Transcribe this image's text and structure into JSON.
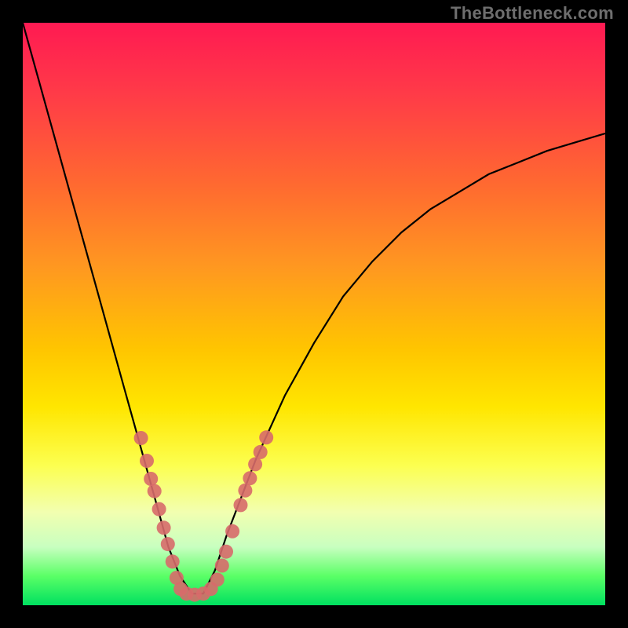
{
  "watermark": "TheBottleneck.com",
  "chart_data": {
    "type": "line",
    "title": "",
    "xlabel": "",
    "ylabel": "",
    "xlim": [
      0,
      1
    ],
    "ylim": [
      0,
      1
    ],
    "grid": false,
    "series": [
      {
        "name": "bottleneck-curve",
        "x": [
          0.0,
          0.025,
          0.05,
          0.075,
          0.1,
          0.125,
          0.15,
          0.175,
          0.2,
          0.225,
          0.25,
          0.27,
          0.29,
          0.31,
          0.33,
          0.35,
          0.4,
          0.45,
          0.5,
          0.55,
          0.6,
          0.65,
          0.7,
          0.75,
          0.8,
          0.85,
          0.9,
          0.95,
          1.0
        ],
        "y": [
          1.0,
          0.91,
          0.82,
          0.73,
          0.64,
          0.55,
          0.46,
          0.37,
          0.28,
          0.19,
          0.1,
          0.05,
          0.02,
          0.02,
          0.06,
          0.12,
          0.25,
          0.36,
          0.45,
          0.53,
          0.59,
          0.64,
          0.68,
          0.71,
          0.74,
          0.76,
          0.78,
          0.795,
          0.81
        ]
      }
    ],
    "markers": {
      "name": "dots",
      "color": "#d76a6a",
      "radius_px": 9,
      "points": [
        {
          "x": 0.203,
          "y": 0.287
        },
        {
          "x": 0.213,
          "y": 0.248
        },
        {
          "x": 0.22,
          "y": 0.217
        },
        {
          "x": 0.226,
          "y": 0.196
        },
        {
          "x": 0.234,
          "y": 0.165
        },
        {
          "x": 0.242,
          "y": 0.133
        },
        {
          "x": 0.249,
          "y": 0.105
        },
        {
          "x": 0.257,
          "y": 0.075
        },
        {
          "x": 0.264,
          "y": 0.047
        },
        {
          "x": 0.271,
          "y": 0.028
        },
        {
          "x": 0.281,
          "y": 0.02
        },
        {
          "x": 0.295,
          "y": 0.018
        },
        {
          "x": 0.31,
          "y": 0.02
        },
        {
          "x": 0.323,
          "y": 0.028
        },
        {
          "x": 0.334,
          "y": 0.044
        },
        {
          "x": 0.342,
          "y": 0.068
        },
        {
          "x": 0.349,
          "y": 0.092
        },
        {
          "x": 0.36,
          "y": 0.127
        },
        {
          "x": 0.374,
          "y": 0.172
        },
        {
          "x": 0.382,
          "y": 0.197
        },
        {
          "x": 0.39,
          "y": 0.218
        },
        {
          "x": 0.399,
          "y": 0.242
        },
        {
          "x": 0.408,
          "y": 0.263
        },
        {
          "x": 0.418,
          "y": 0.288
        }
      ]
    },
    "annotations": []
  }
}
